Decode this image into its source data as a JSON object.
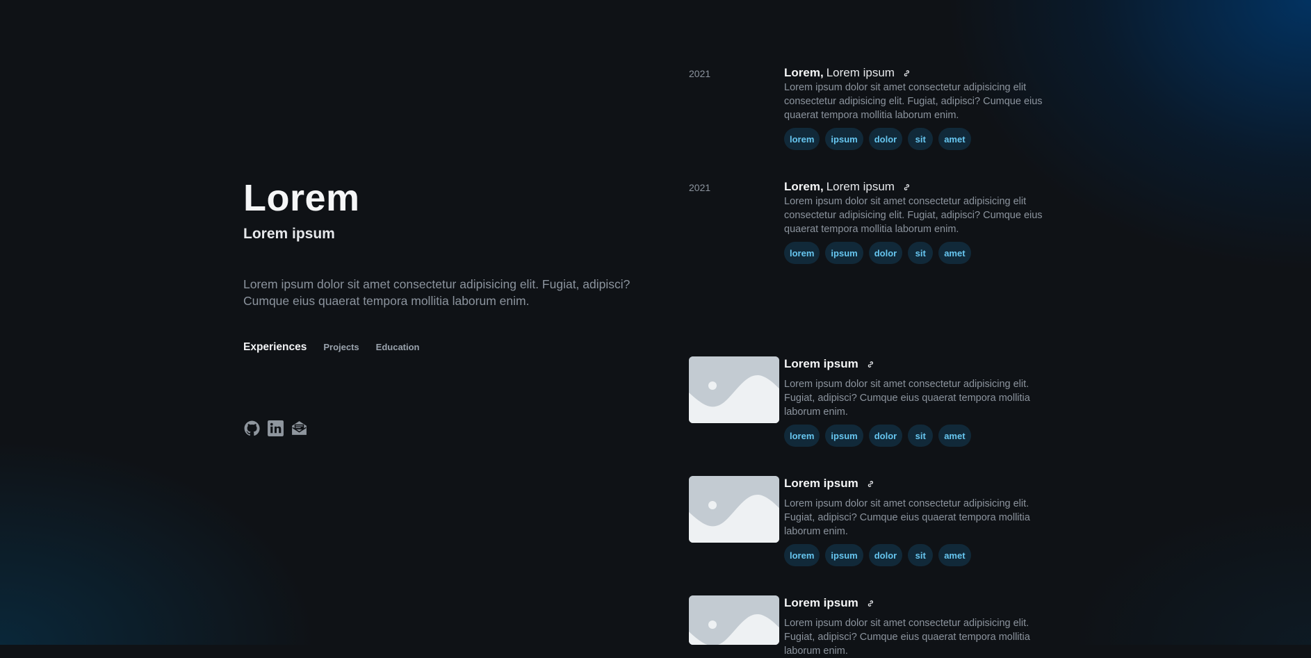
{
  "hero": {
    "title": "Lorem",
    "subtitle": "Lorem ipsum",
    "description": "Lorem ipsum dolor sit amet consectetur adipisicing elit. Fugiat, adipisci? Cumque eius quaerat tempora mollitia laborum enim."
  },
  "nav": {
    "items": [
      {
        "label": "Experiences",
        "active": true
      },
      {
        "label": "Projects",
        "active": false
      },
      {
        "label": "Education",
        "active": false
      }
    ]
  },
  "socials": {
    "icons": [
      "github-icon",
      "linkedin-icon",
      "mail-icon"
    ]
  },
  "experiences": [
    {
      "year": "2021",
      "company": "Lorem,",
      "role": "Lorem ipsum",
      "description": "Lorem ipsum dolor sit amet consectetur adipisicing elit consectetur adipisicing elit. Fugiat, adipisci? Cumque eius quaerat tempora mollitia laborum enim.",
      "tags": [
        "lorem",
        "ipsum",
        "dolor",
        "sit",
        "amet"
      ]
    },
    {
      "year": "2021",
      "company": "Lorem,",
      "role": "Lorem ipsum",
      "description": "Lorem ipsum dolor sit amet consectetur adipisicing elit consectetur adipisicing elit. Fugiat, adipisci? Cumque eius quaerat tempora mollitia laborum enim.",
      "tags": [
        "lorem",
        "ipsum",
        "dolor",
        "sit",
        "amet"
      ]
    }
  ],
  "projects": [
    {
      "title": "Lorem ipsum",
      "description": "Lorem ipsum dolor sit amet consectetur adipisicing elit. Fugiat, adipisci? Cumque eius quaerat tempora mollitia laborum enim.",
      "tags": [
        "lorem",
        "ipsum",
        "dolor",
        "sit",
        "amet"
      ]
    },
    {
      "title": "Lorem ipsum",
      "description": "Lorem ipsum dolor sit amet consectetur adipisicing elit. Fugiat, adipisci? Cumque eius quaerat tempora mollitia laborum enim.",
      "tags": [
        "lorem",
        "ipsum",
        "dolor",
        "sit",
        "amet"
      ]
    },
    {
      "title": "Lorem ipsum",
      "description": "Lorem ipsum dolor sit amet consectetur adipisicing elit. Fugiat, adipisci? Cumque eius quaerat tempora mollitia laborum enim.",
      "tags": []
    }
  ],
  "colors": {
    "background": "#0f1216",
    "accent_tag_text": "#67c6f0",
    "muted_text": "#8c949e",
    "heading_text": "#f5f6f7"
  }
}
